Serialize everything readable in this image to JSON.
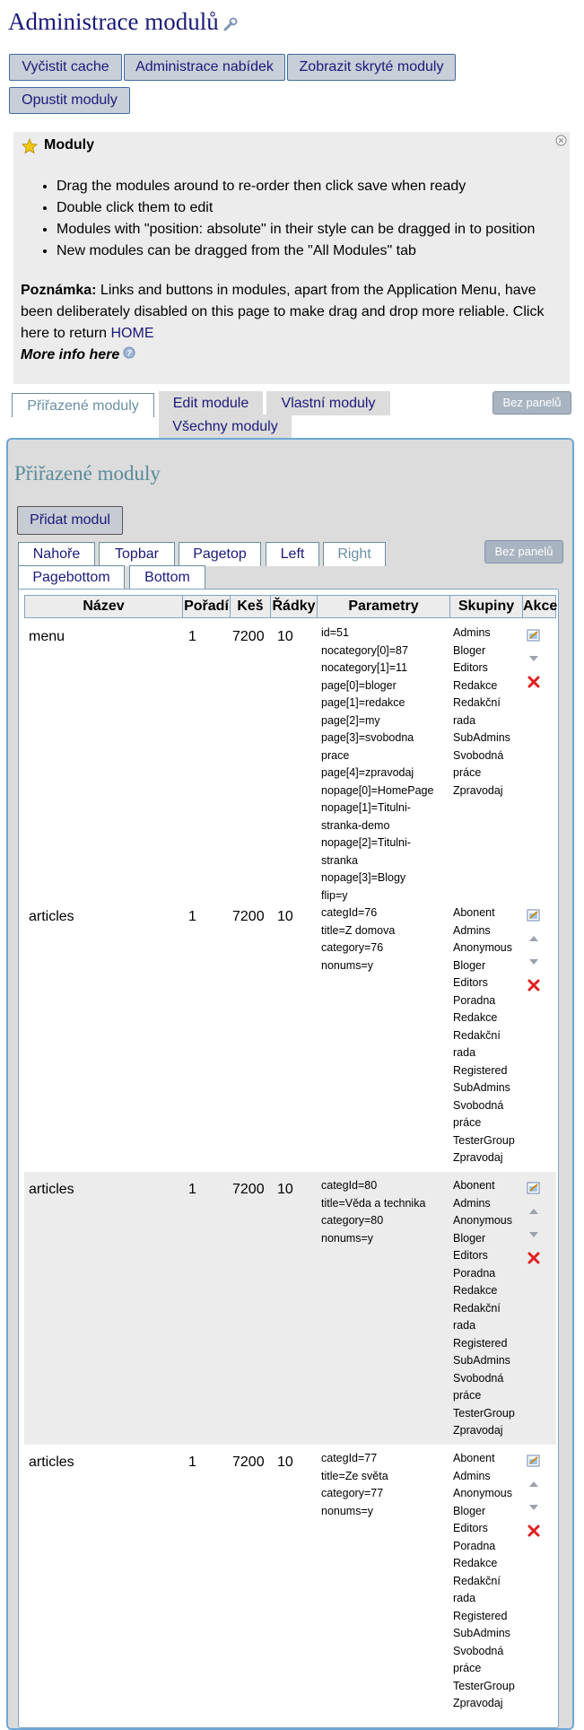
{
  "page_title": "Administrace modulů",
  "toolbar": {
    "clear_cache": "Vyčistit cache",
    "menu_admin": "Administrace nabídek",
    "show_hidden": "Zobrazit skryté moduly",
    "exit_modules": "Opustit moduly"
  },
  "info": {
    "tab_label": "Moduly",
    "bullets": [
      "Drag the modules around to re-order then click save when ready",
      "Double click them to edit",
      "Modules with \"position: absolute\" in their style can be dragged in to position",
      "New modules can be dragged from the \"All Modules\" tab"
    ],
    "note_label": "Poznámka:",
    "note_text": " Links and buttons in modules, apart from the Application Menu, have been deliberately disabled on this page to make drag and drop more reliable. Click here to return ",
    "home_link": "HOME",
    "more_info": "More info here"
  },
  "main_tabs": [
    "Přiřazené moduly",
    "Edit module",
    "Vlastní moduly",
    "Všechny moduly"
  ],
  "no_panels": "Bez panelů",
  "panel": {
    "title": "Přiřazené moduly",
    "add_module": "Přidat modul",
    "position_tabs": [
      "Nahoře",
      "Topbar",
      "Pagetop",
      "Left",
      "Right",
      "Pagebottom",
      "Bottom"
    ],
    "selected_position": "Right"
  },
  "table": {
    "headers": [
      "Název",
      "Pořadí",
      "Keš",
      "Řádky",
      "Parametry",
      "Skupiny",
      "Akce"
    ],
    "rows": [
      {
        "name": "menu",
        "order": "1",
        "cache": "7200",
        "rows": "10",
        "params": [
          "id=51",
          "nocategory[0]=87",
          "nocategory[1]=11",
          "page[0]=bloger",
          "page[1]=redakce",
          "page[2]=my",
          "page[3]=svobodna",
          "prace",
          "page[4]=zpravodaj",
          "nopage[0]=HomePage",
          "nopage[1]=Titulni-",
          "stranka-demo",
          "nopage[2]=Titulni-",
          "stranka",
          "nopage[3]=Blogy",
          "flip=y"
        ],
        "groups": [
          "Admins",
          "Bloger",
          "Editors",
          "Redakce",
          "Redakční",
          "rada",
          "SubAdmins",
          "Svobodná",
          "práce",
          "Zpravodaj"
        ],
        "actions": [
          "edit-icon",
          "arrow-down-icon",
          "delete-icon"
        ]
      },
      {
        "name": "articles",
        "order": "1",
        "cache": "7200",
        "rows": "10",
        "params": [
          "categId=76",
          "title=Z domova",
          "category=76",
          "nonums=y"
        ],
        "groups": [
          "Abonent",
          "Admins",
          "Anonymous",
          "Bloger",
          "Editors",
          "Poradna",
          "Redakce",
          "Redakční",
          "rada",
          "Registered",
          "SubAdmins",
          "Svobodná",
          "práce",
          "TesterGroup",
          "Zpravodaj"
        ],
        "actions": [
          "edit-icon",
          "arrow-up-icon",
          "arrow-down-icon",
          "delete-icon"
        ]
      },
      {
        "name": "articles",
        "order": "1",
        "cache": "7200",
        "rows": "10",
        "params": [
          "categId=80",
          "title=Věda a technika",
          "category=80",
          "nonums=y"
        ],
        "groups": [
          "Abonent",
          "Admins",
          "Anonymous",
          "Bloger",
          "Editors",
          "Poradna",
          "Redakce",
          "Redakční",
          "rada",
          "Registered",
          "SubAdmins",
          "Svobodná",
          "práce",
          "TesterGroup",
          "Zpravodaj"
        ],
        "actions": [
          "edit-icon",
          "arrow-up-icon",
          "arrow-down-icon",
          "delete-icon"
        ]
      },
      {
        "name": "articles",
        "order": "1",
        "cache": "7200",
        "rows": "10",
        "params": [
          "categId=77",
          "title=Ze světa",
          "category=77",
          "nonums=y"
        ],
        "groups": [
          "Abonent",
          "Admins",
          "Anonymous",
          "Bloger",
          "Editors",
          "Poradna",
          "Redakce",
          "Redakční",
          "rada",
          "Registered",
          "SubAdmins",
          "Svobodná",
          "práce",
          "TesterGroup",
          "Zpravodaj"
        ],
        "actions": [
          "edit-icon",
          "arrow-up-icon",
          "arrow-down-icon",
          "delete-icon"
        ]
      }
    ]
  },
  "colors": {
    "link": "#1a1a7a",
    "panel_border": "#6ea7d6",
    "button_bg": "#c9cfd8",
    "delete": "#e02020"
  }
}
